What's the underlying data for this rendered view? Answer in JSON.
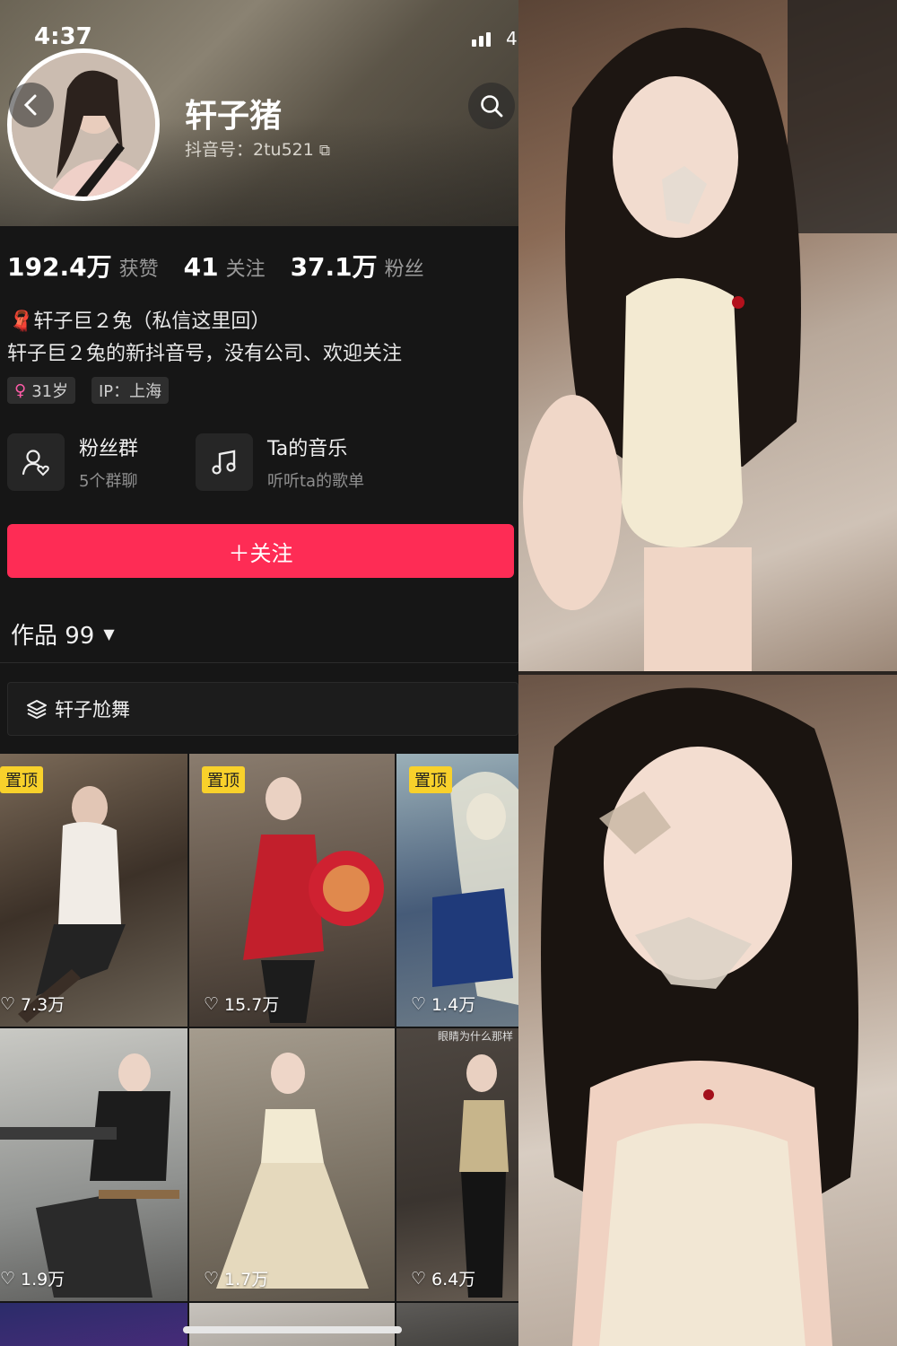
{
  "status_bar": {
    "time": "4:37",
    "battery": "4"
  },
  "profile": {
    "name": "轩子猪",
    "douyin_id": "抖音号：2tu521",
    "stats": [
      {
        "value": "192.4万",
        "label": "获赞"
      },
      {
        "value": "41",
        "label": "关注"
      },
      {
        "value": "37.1万",
        "label": "粉丝"
      }
    ],
    "bio_line1": "轩子巨２兔（私信这里回）",
    "bio_line2": "轩子巨２兔的新抖音号，没有公司、欢迎关注",
    "tag_age": "31岁",
    "tag_ip": "IP：上海"
  },
  "cards": [
    {
      "title": "粉丝群",
      "subtitle": "5个群聊",
      "icon": "fans-group-icon"
    },
    {
      "title": "Ta的音乐",
      "subtitle": "听听ta的歌单",
      "icon": "music-note-icon"
    }
  ],
  "follow_button": "＋关注",
  "works_label": "作品 99",
  "collection_label": "轩子尬舞",
  "videos": [
    {
      "likes": "7.3万",
      "pinned": "置顶"
    },
    {
      "likes": "15.7万",
      "pinned": "置顶"
    },
    {
      "likes": "1.4万",
      "pinned": "置顶"
    },
    {
      "likes": "1.9万",
      "pinned": ""
    },
    {
      "likes": "1.7万",
      "pinned": ""
    },
    {
      "likes": "6.4万",
      "pinned": "",
      "caption": "眼睛为什么那样"
    }
  ],
  "colors": {
    "accent": "#fe2c55",
    "pin": "#f8d12b",
    "background": "#161616"
  }
}
